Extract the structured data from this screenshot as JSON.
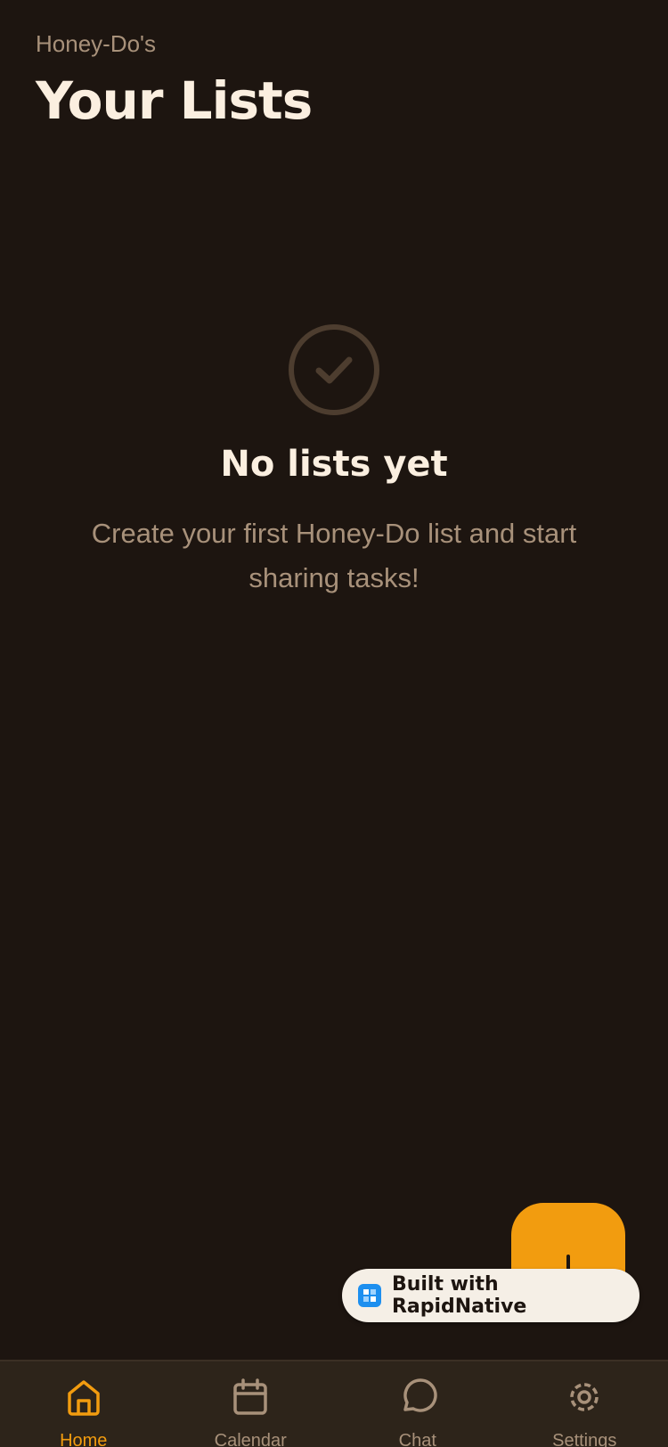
{
  "header": {
    "eyebrow": "Honey-Do's",
    "title": "Your Lists"
  },
  "empty_state": {
    "icon": "check-circle-icon",
    "title": "No lists yet",
    "subtitle": "Create your first Honey-Do list and start sharing tasks!"
  },
  "fab": {
    "icon": "plus-icon"
  },
  "badge": {
    "text": "Built with RapidNative"
  },
  "tabs": [
    {
      "label": "Home",
      "icon": "home-icon",
      "active": true
    },
    {
      "label": "Calendar",
      "icon": "calendar-icon",
      "active": false
    },
    {
      "label": "Chat",
      "icon": "chat-bubble-icon",
      "active": false
    },
    {
      "label": "Settings",
      "icon": "gear-icon",
      "active": false
    }
  ],
  "colors": {
    "background": "#1d1510",
    "accent": "#f29c0f",
    "text_primary": "#fbefe0",
    "text_muted": "#a8917a",
    "tabbar": "#2d241a"
  }
}
